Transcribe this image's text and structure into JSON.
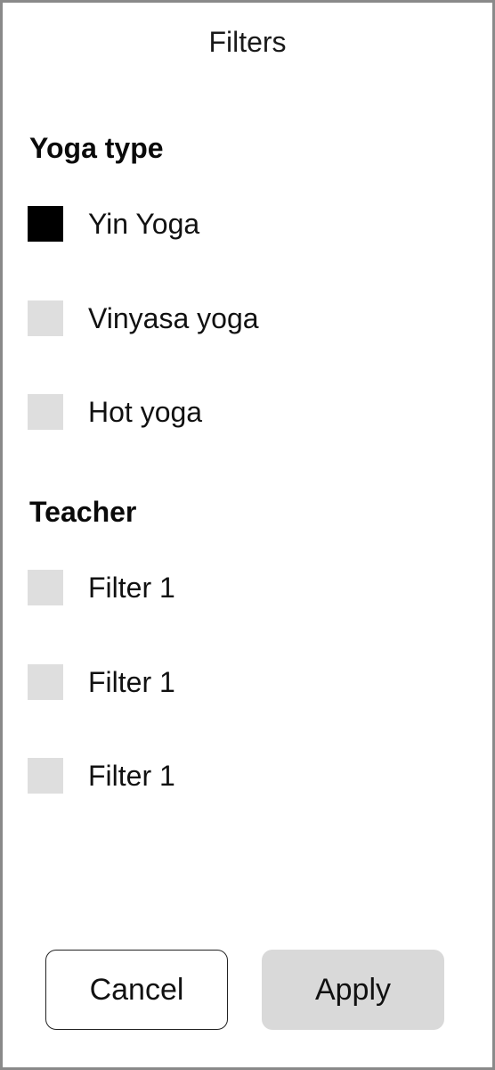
{
  "header": {
    "title": "Filters"
  },
  "sections": [
    {
      "heading": "Yoga type",
      "options": [
        {
          "label": "Yin Yoga",
          "checked": true
        },
        {
          "label": "Vinyasa yoga",
          "checked": false
        },
        {
          "label": "Hot yoga",
          "checked": false
        }
      ]
    },
    {
      "heading": "Teacher",
      "options": [
        {
          "label": "Filter 1",
          "checked": false
        },
        {
          "label": "Filter 1",
          "checked": false
        },
        {
          "label": "Filter 1",
          "checked": false
        }
      ]
    }
  ],
  "actions": {
    "cancel_label": "Cancel",
    "apply_label": "Apply"
  },
  "colors": {
    "checkbox_checked": "#000000",
    "checkbox_unchecked": "#dedede",
    "apply_background": "#d9d9d9",
    "frame_border": "#8a8a8a"
  }
}
